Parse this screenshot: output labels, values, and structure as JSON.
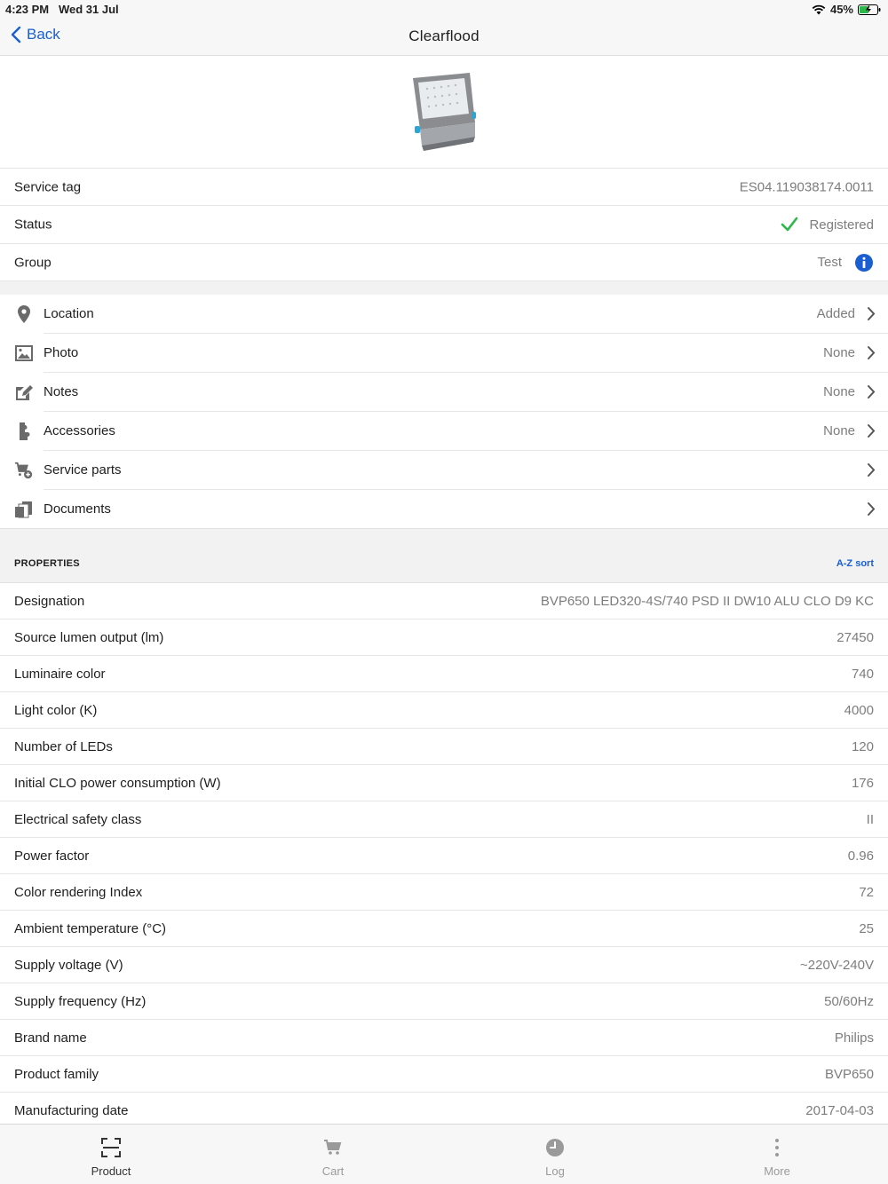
{
  "status_bar": {
    "time": "4:23 PM",
    "date": "Wed 31 Jul",
    "battery": "45%"
  },
  "nav": {
    "back_label": "Back",
    "title": "Clearflood"
  },
  "info": {
    "service_tag": {
      "label": "Service tag",
      "value": "ES04.119038174.0011"
    },
    "status": {
      "label": "Status",
      "value": "Registered"
    },
    "group": {
      "label": "Group",
      "value": "Test"
    }
  },
  "menu": [
    {
      "label": "Location",
      "value": "Added",
      "icon": "location-pin-icon"
    },
    {
      "label": "Photo",
      "value": "None",
      "icon": "photo-icon"
    },
    {
      "label": "Notes",
      "value": "None",
      "icon": "pencil-icon"
    },
    {
      "label": "Accessories",
      "value": "None",
      "icon": "puzzle-icon"
    },
    {
      "label": "Service parts",
      "value": "",
      "icon": "cart-add-icon"
    },
    {
      "label": "Documents",
      "value": "",
      "icon": "documents-icon"
    }
  ],
  "properties": {
    "header": "PROPERTIES",
    "sort_label": "A-Z sort",
    "rows": [
      {
        "label": "Designation",
        "value": "BVP650 LED320-4S/740 PSD II DW10 ALU CLO D9 KC"
      },
      {
        "label": "Source lumen output (lm)",
        "value": "27450"
      },
      {
        "label": "Luminaire color",
        "value": "740"
      },
      {
        "label": "Light color (K)",
        "value": "4000"
      },
      {
        "label": "Number of LEDs",
        "value": "120"
      },
      {
        "label": "Initial CLO power consumption (W)",
        "value": "176"
      },
      {
        "label": "Electrical safety class",
        "value": "II"
      },
      {
        "label": "Power factor",
        "value": "0.96"
      },
      {
        "label": "Color rendering Index",
        "value": "72"
      },
      {
        "label": "Ambient temperature (°C)",
        "value": "25"
      },
      {
        "label": "Supply voltage (V)",
        "value": "~220V-240V"
      },
      {
        "label": "Supply frequency (Hz)",
        "value": "50/60Hz"
      },
      {
        "label": "Brand name",
        "value": "Philips"
      },
      {
        "label": "Product family",
        "value": "BVP650"
      },
      {
        "label": "Manufacturing date",
        "value": "2017-04-03"
      }
    ]
  },
  "tabs": [
    {
      "label": "Product",
      "icon": "scan-icon",
      "active": true
    },
    {
      "label": "Cart",
      "icon": "cart-icon",
      "active": false
    },
    {
      "label": "Log",
      "icon": "clock-icon",
      "active": false
    },
    {
      "label": "More",
      "icon": "more-dots-icon",
      "active": false
    }
  ],
  "colors": {
    "accent": "#1a5fd1",
    "success": "#2cb84a",
    "secondary_text": "#7d7d7d"
  }
}
